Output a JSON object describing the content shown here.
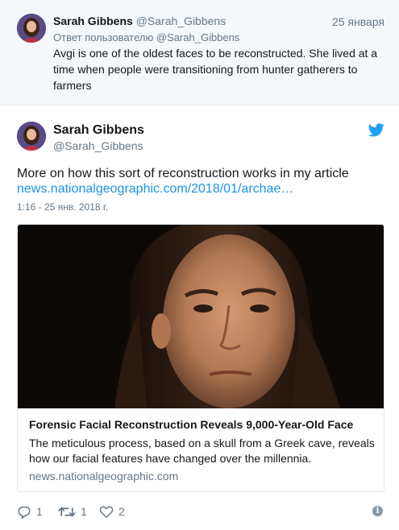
{
  "parent_tweet": {
    "name": "Sarah Gibbens",
    "handle": "@Sarah_Gibbens",
    "date": "25 января",
    "reply_to": "Ответ пользователю @Sarah_Gibbens",
    "text": "Avgi is one of the oldest faces to be reconstructed. She lived at a time when people were transitioning from hunter gatherers to farmers"
  },
  "main_tweet": {
    "name": "Sarah Gibbens",
    "handle": "@Sarah_Gibbens",
    "text": "More on how this sort of reconstruction works in my article",
    "link": "news.nationalgeographic.com/2018/01/archae…",
    "timestamp": "1:16 - 25 янв. 2018 г."
  },
  "card": {
    "title": "Forensic Facial Reconstruction Reveals 9,000-Year-Old Face",
    "description": "The meticulous process, based on a skull from a Greek cave, reveals how our facial features have changed over the millennia.",
    "domain": "news.nationalgeographic.com"
  },
  "actions": {
    "reply_count": "1",
    "retweet_count": "1",
    "like_count": "2"
  },
  "icons": {
    "bird": "twitter-bird-icon",
    "reply": "reply-icon",
    "retweet": "retweet-icon",
    "like": "heart-icon",
    "info": "info-icon"
  },
  "colors": {
    "link": "#1b95e0",
    "muted": "#657786",
    "parent_bg": "#f5f8fa",
    "border": "#e1e8ed"
  }
}
